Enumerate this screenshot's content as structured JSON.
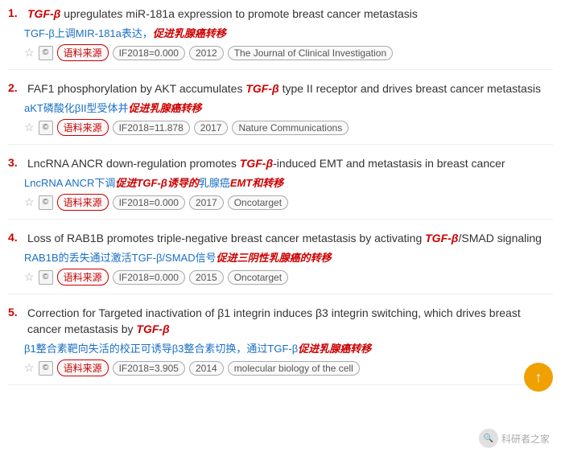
{
  "results": [
    {
      "number": "1.",
      "title_parts": [
        {
          "text": "TGF-β",
          "italic_red": true
        },
        {
          "text": " upregulates miR-181a expression to promote breast cancer metastasis",
          "italic_red": false
        }
      ],
      "chinese_title_parts": [
        {
          "text": "TGF-β上调MIR-181a表达，",
          "italic_red": false
        },
        {
          "text": "促进乳腺癌转移",
          "italic_red": true
        }
      ],
      "source_tag": "语料来源",
      "if_tag": "IF2018=0.000",
      "year_tag": "2012",
      "journal_tag": "The Journal of Clinical Investigation"
    },
    {
      "number": "2.",
      "title_parts": [
        {
          "text": "FAF1 phosphorylation by AKT accumulates ",
          "italic_red": false
        },
        {
          "text": "TGF-β",
          "italic_red": true
        },
        {
          "text": " type II receptor and drives breast cancer metastasis",
          "italic_red": false
        }
      ],
      "chinese_title_parts": [
        {
          "text": "aKT磷酸化βII型受体并",
          "italic_red": false
        },
        {
          "text": "促进乳腺癌转移",
          "italic_red": true
        }
      ],
      "source_tag": "语料来源",
      "if_tag": "IF2018=11.878",
      "year_tag": "2017",
      "journal_tag": "Nature Communications"
    },
    {
      "number": "3.",
      "title_parts": [
        {
          "text": "LncRNA ANCR down-regulation promotes ",
          "italic_red": false
        },
        {
          "text": "TGF-β",
          "italic_red": true
        },
        {
          "text": "-induced EMT and metastasis in breast cancer",
          "italic_red": false
        }
      ],
      "chinese_title_parts": [
        {
          "text": "LncRNA ANCR下调",
          "italic_red": false
        },
        {
          "text": "促进TGF-β诱导的",
          "italic_red": true
        },
        {
          "text": "乳腺癌",
          "italic_red": false
        },
        {
          "text": "EMT和",
          "italic_red": true
        },
        {
          "text": "转移",
          "italic_red": true
        }
      ],
      "source_tag": "语料来源",
      "if_tag": "IF2018=0.000",
      "year_tag": "2017",
      "journal_tag": "Oncotarget"
    },
    {
      "number": "4.",
      "title_parts": [
        {
          "text": "Loss of RAB1B promotes triple-negative breast cancer metastasis by activating ",
          "italic_red": false
        },
        {
          "text": "TGF-β",
          "italic_red": true
        },
        {
          "text": "/SMAD signaling",
          "italic_red": false
        }
      ],
      "chinese_title_parts": [
        {
          "text": "RAB1B的丢失通过激活TGF-β/SMAD信号",
          "italic_red": false
        },
        {
          "text": "促进三阴性乳腺癌的",
          "italic_red": true
        },
        {
          "text": "转移",
          "italic_red": true
        }
      ],
      "source_tag": "语料来源",
      "if_tag": "IF2018=0.000",
      "year_tag": "2015",
      "journal_tag": "Oncotarget"
    },
    {
      "number": "5.",
      "title_parts": [
        {
          "text": "Correction for Targeted inactivation of β1 integrin induces β3 integrin switching, which drives breast cancer metastasis by ",
          "italic_red": false
        },
        {
          "text": "TGF-β",
          "italic_red": true
        }
      ],
      "chinese_title_parts": [
        {
          "text": "β1整合素靶向失活的校正可诱导β3整合素切换，通过TGF-β",
          "italic_red": false
        },
        {
          "text": "促进乳腺癌转移",
          "italic_red": true
        }
      ],
      "source_tag": "语料来源",
      "if_tag": "IF2018=3.905",
      "year_tag": "2014",
      "journal_tag": "molecular biology of the cell"
    }
  ],
  "scroll_up_label": "↑",
  "watermark_text": "科研者之家",
  "cite_icon_label": "©",
  "star_label": "☆"
}
